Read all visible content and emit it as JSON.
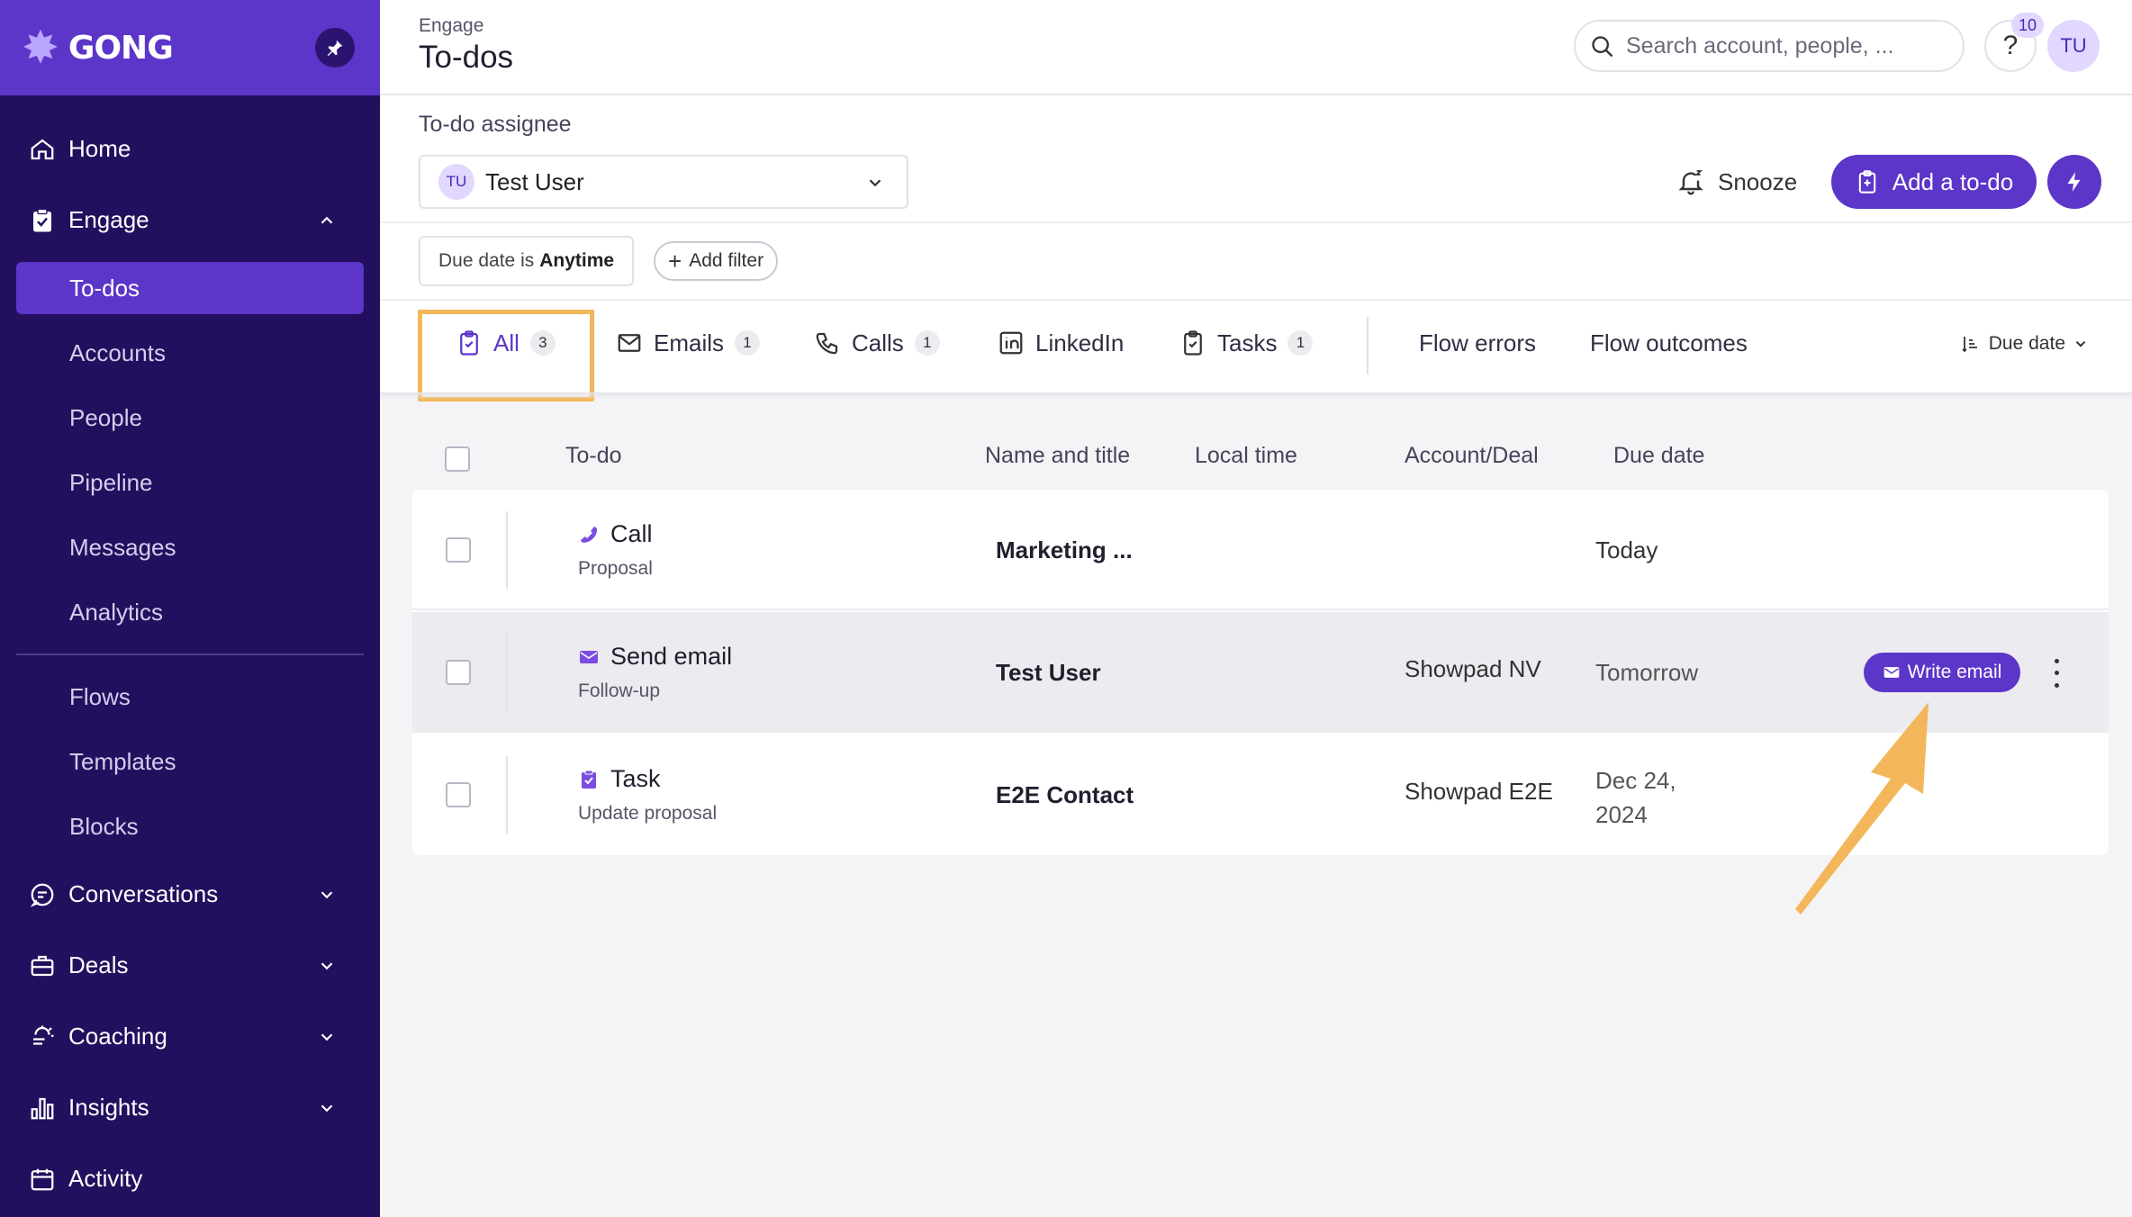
{
  "brand": {
    "name": "GONG"
  },
  "sidebar": {
    "items": [
      {
        "label": "Home",
        "icon": "home-icon"
      },
      {
        "label": "Engage",
        "icon": "clipboard-check-icon",
        "expanded": true,
        "children": [
          "To-dos",
          "Accounts",
          "People",
          "Pipeline",
          "Messages",
          "Analytics"
        ],
        "children2": [
          "Flows",
          "Templates",
          "Blocks"
        ]
      },
      {
        "label": "Conversations",
        "icon": "chat-icon"
      },
      {
        "label": "Deals",
        "icon": "briefcase-icon"
      },
      {
        "label": "Coaching",
        "icon": "coaching-icon"
      },
      {
        "label": "Insights",
        "icon": "bar-chart-icon"
      },
      {
        "label": "Activity",
        "icon": "calendar-icon"
      }
    ],
    "active": "To-dos"
  },
  "header": {
    "breadcrumb": "Engage",
    "title": "To-dos",
    "search_placeholder": "Search account, people, ...",
    "help_label": "?",
    "notification_count": "10",
    "user_initials": "TU"
  },
  "assignee": {
    "label": "To-do assignee",
    "initials": "TU",
    "value": "Test User"
  },
  "actions": {
    "snooze": "Snooze",
    "add_todo": "Add a to-do"
  },
  "filters": {
    "due_prefix": "Due date is",
    "due_value": "Anytime",
    "add_filter": "Add filter"
  },
  "tabs": [
    {
      "label": "All",
      "count": "3",
      "icon": "clipboard-icon"
    },
    {
      "label": "Emails",
      "count": "1",
      "icon": "mail-icon"
    },
    {
      "label": "Calls",
      "count": "1",
      "icon": "phone-icon"
    },
    {
      "label": "LinkedIn",
      "count": "",
      "icon": "linkedin-icon"
    },
    {
      "label": "Tasks",
      "count": "1",
      "icon": "clipboard-icon"
    },
    {
      "label": "Flow errors"
    },
    {
      "label": "Flow outcomes"
    }
  ],
  "sort": {
    "label": "Due date"
  },
  "table": {
    "columns": [
      "To-do",
      "Name and title",
      "Local time",
      "Account/Deal",
      "Due date"
    ],
    "rows": [
      {
        "type": "Call",
        "sub": "Proposal",
        "name": "Marketing ...",
        "local_time": "",
        "account": "",
        "due": "Today",
        "icon": "phone-icon"
      },
      {
        "type": "Send email",
        "sub": "Follow-up",
        "name": "Test User",
        "local_time": "",
        "account": "Showpad NV",
        "due": "Tomorrow",
        "icon": "mail-icon",
        "action": "Write email"
      },
      {
        "type": "Task",
        "sub": "Update proposal",
        "name": "E2E Contact",
        "local_time": "",
        "account": "Showpad E2E",
        "due_line1": "Dec 24,",
        "due_line2": "2024",
        "icon": "task-icon"
      }
    ]
  },
  "colors": {
    "sidebar_bg": "#22105e",
    "accent": "#5c35c9",
    "highlight": "#f3b65a"
  }
}
